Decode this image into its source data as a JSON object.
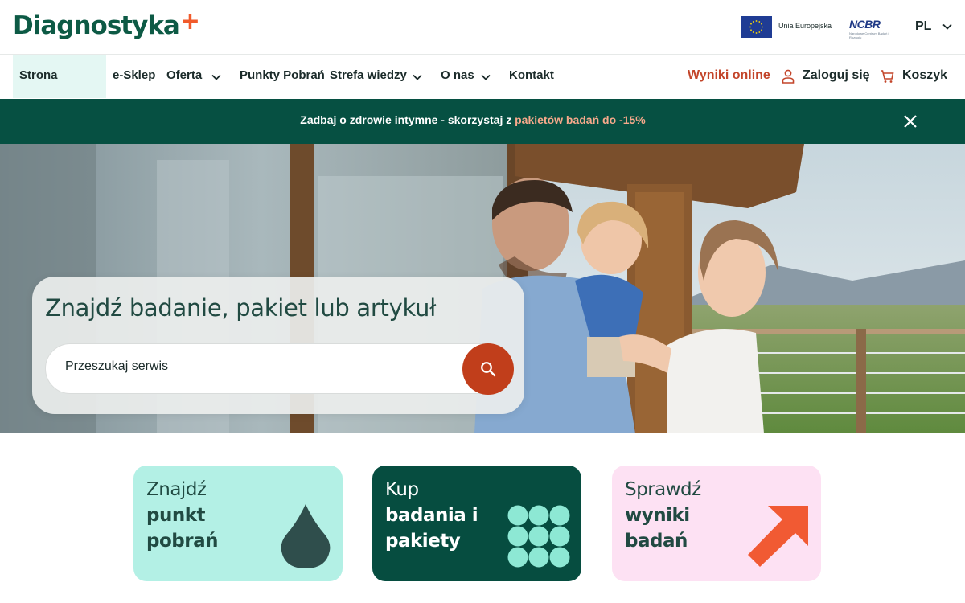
{
  "header": {
    "logo_text": "Diagnostyka",
    "logo_plus": "+",
    "eu_label": "Unia Europejska",
    "ncbr_label": "NCBR",
    "ncbr_sub": "Narodowe Centrum Badań i Rozwoju",
    "language": "PL"
  },
  "nav": {
    "items": [
      {
        "label": "Strona Główna"
      },
      {
        "label": "e-Sklep"
      },
      {
        "label": "Oferta"
      },
      {
        "label": "Punkty Pobrań"
      },
      {
        "label": "Strefa wiedzy"
      },
      {
        "label": "O nas"
      },
      {
        "label": "Kontakt"
      }
    ],
    "results_label": "Wyniki online",
    "login_label": "Zaloguj się",
    "cart_label": "Koszyk"
  },
  "promo": {
    "text": "Zadbaj o zdrowie intymne - skorzystaj z ",
    "link": "pakietów badań do -15%"
  },
  "hero": {
    "title": "Znajdź badanie, pakiet lub artykuł",
    "search_placeholder": "Przeszukaj serwis"
  },
  "tiles": [
    {
      "line1": "Znajdź",
      "line2": "punkt",
      "line3": "pobrań",
      "bg": "#b3f0e5",
      "fg": "#214a42"
    },
    {
      "line1": "Kup",
      "line2": "badania i",
      "line3": "pakiety",
      "bg": "#064d40",
      "fg": "#ffffff"
    },
    {
      "line1": "Sprawdź",
      "line2": "wyniki",
      "line3": "badań",
      "bg": "#fde1f3",
      "fg": "#214a42"
    }
  ],
  "colors": {
    "brand_green": "#0d5a45",
    "accent_orange": "#f15a2b",
    "promo_bg": "#065042",
    "search_button": "#c13e1b"
  }
}
